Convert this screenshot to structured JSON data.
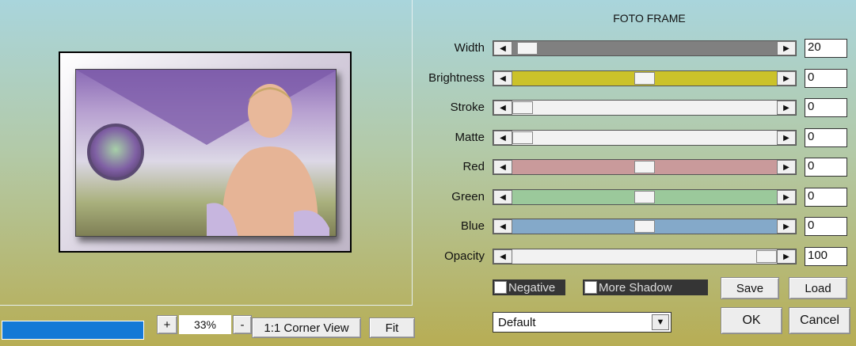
{
  "title": "FOTO FRAME",
  "zoom": {
    "plus": "+",
    "minus": "-",
    "value": "33%"
  },
  "buttons": {
    "corner_view": "1:1 Corner View",
    "fit": "Fit",
    "save": "Save",
    "load": "Load",
    "ok": "OK",
    "cancel": "Cancel"
  },
  "sliders": [
    {
      "label": "Width",
      "value": "20",
      "fill": "#808080",
      "level": 0.02
    },
    {
      "label": "Brightness",
      "value": "0",
      "fill": "#cbc22a",
      "level": 0.5
    },
    {
      "label": "Stroke",
      "value": "0",
      "fill": "#f2f2f2",
      "level": 0.0
    },
    {
      "label": "Matte",
      "value": "0",
      "fill": "#f2f2f2",
      "level": 0.0
    },
    {
      "label": "Red",
      "value": "0",
      "fill": "#c99a9b",
      "level": 0.5
    },
    {
      "label": "Green",
      "value": "0",
      "fill": "#9bc99b",
      "level": 0.5
    },
    {
      "label": "Blue",
      "value": "0",
      "fill": "#84a9c9",
      "level": 0.5
    },
    {
      "label": "Opacity",
      "value": "100",
      "fill": "#f2f2f2",
      "level": 1.0
    }
  ],
  "checkboxes": {
    "negative": "Negative",
    "more_shadow": "More Shadow"
  },
  "preset": {
    "selected": "Default"
  }
}
